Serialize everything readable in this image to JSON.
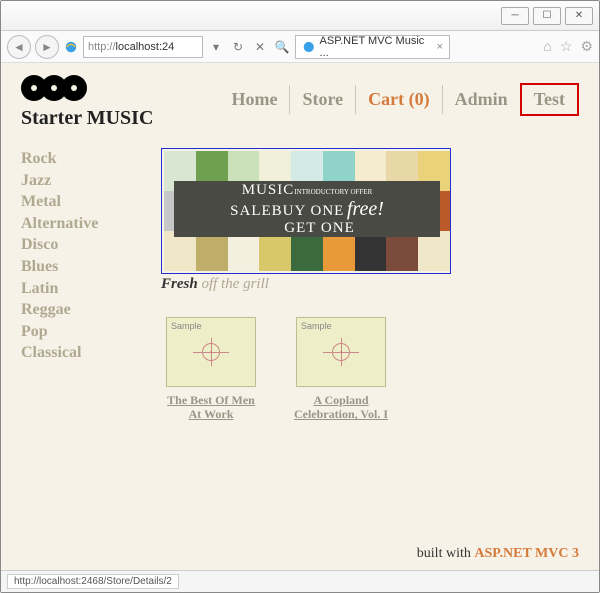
{
  "window": {
    "url_prefix": "http://",
    "url_host": "localhost:24",
    "tab_title": "ASP.NET MVC Music ..."
  },
  "brand": "Starter MUSIC",
  "nav": {
    "home": "Home",
    "store": "Store",
    "cart": "Cart (0)",
    "admin": "Admin",
    "test": "Test"
  },
  "sidebar": [
    "Rock",
    "Jazz",
    "Metal",
    "Alternative",
    "Disco",
    "Blues",
    "Latin",
    "Reggae",
    "Pop",
    "Classical"
  ],
  "banner": {
    "line1_left": "MUSIC",
    "line1_right": "INTRODUCTORY OFFER",
    "line2_left": "SALE",
    "line2_mid": "BUY ONE",
    "line3": "GET ONE",
    "free": "free!",
    "mosaic_colors": [
      [
        "#d9e6d2",
        "#6fa04f",
        "#c9e0b8",
        "#f0f0d8",
        "#d4ebe5",
        "#8fd3c9",
        "#f5ecd0",
        "#e8d8a8",
        "#ead27a"
      ],
      [
        "#c7c7c7",
        "#4a4a44",
        "#4a4a44",
        "#4a4a44",
        "#4a4a44",
        "#4a4a44",
        "#4a4a44",
        "#4a4a44",
        "#ba5a2a"
      ],
      [
        "#efe7c8",
        "#bfae6a",
        "#f4f0df",
        "#d8c86a",
        "#3b6a3f",
        "#e89a3a",
        "#333333",
        "#7a4a3a",
        "#efe7c8"
      ]
    ]
  },
  "tagline_fresh": "Fresh",
  "tagline_rest": " off the grill",
  "albums": [
    {
      "sample": "Sample",
      "title": "The Best Of Men At Work"
    },
    {
      "sample": "Sample",
      "title": "A Copland Celebration, Vol. I"
    }
  ],
  "footer_prefix": "built with ",
  "footer_mvc": "ASP.NET MVC 3",
  "status": "http://localhost:2468/Store/Details/2"
}
